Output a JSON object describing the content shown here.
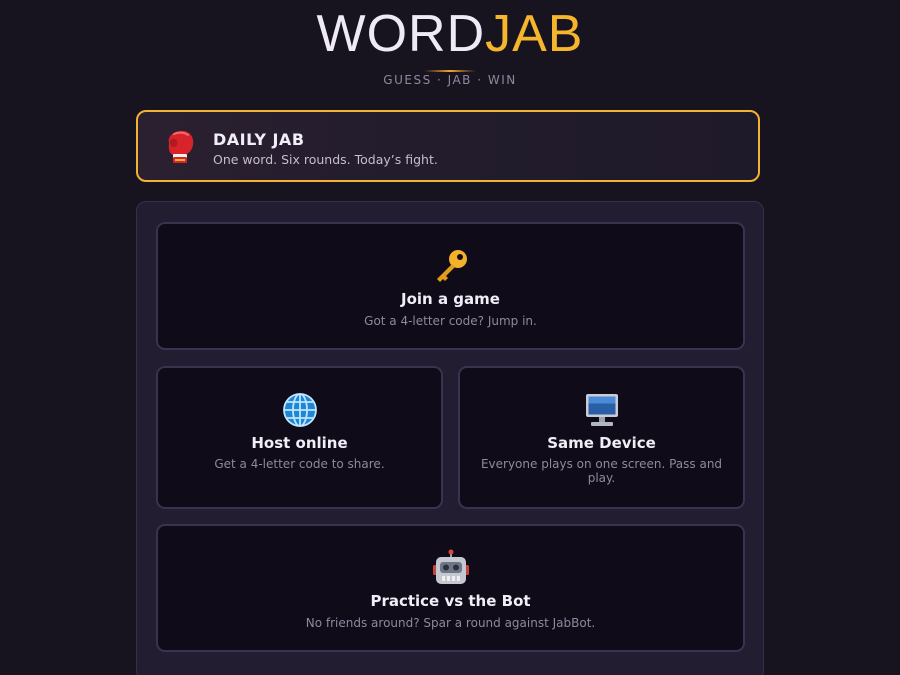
{
  "header": {
    "logo_word1": "WORD",
    "logo_word2": "JAB",
    "tagline": "GUESS · JAB · WIN"
  },
  "daily": {
    "icon": "boxing-glove-icon",
    "title": "DAILY JAB",
    "subtitle": "One word. Six rounds. Today’s fight."
  },
  "modes": {
    "join": {
      "icon": "key-icon",
      "title": "Join a game",
      "subtitle": "Got a 4-letter code? Jump in."
    },
    "host": {
      "icon": "globe-icon",
      "title": "Host online",
      "subtitle": "Get a 4-letter code to share."
    },
    "same_device": {
      "icon": "desktop-computer-icon",
      "title": "Same Device",
      "subtitle": "Everyone plays on one screen. Pass and play."
    },
    "bot": {
      "icon": "robot-icon",
      "title": "Practice vs the Bot",
      "subtitle": "No friends around? Spar a round against JabBot."
    }
  },
  "colors": {
    "background": "#17131f",
    "accent": "#f5b52c",
    "panel": "#221d31",
    "card": "#100b18"
  }
}
